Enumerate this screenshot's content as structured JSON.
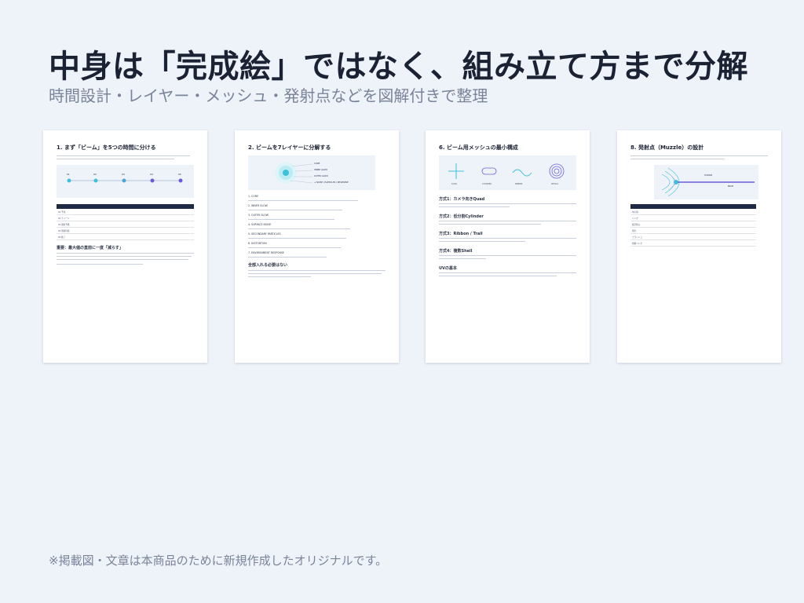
{
  "header": {
    "title": "中身は「完成絵」ではなく、組み立て方まで分解",
    "subtitle": "時間設計・レイヤー・メッシュ・発射点などを図解付きで整理"
  },
  "footer": {
    "note": "※掲載図・文章は本商品のために新規作成したオリジナルです。"
  },
  "pages": [
    {
      "title": "1. まず「ビーム」を5つの時間に分ける",
      "subheading": "重要：最大値の直前に一度「減らす」",
      "timeline_labels": [
        "01",
        "02",
        "03",
        "04",
        "05"
      ],
      "table_rows": [
        [
          "01 予兆",
          "",
          "",
          ""
        ],
        [
          "02 チャージ",
          "",
          "",
          ""
        ],
        [
          "03 発射予備",
          "",
          "",
          ""
        ],
        [
          "04 照射持続",
          "",
          "",
          ""
        ],
        [
          "05 終了",
          "",
          "",
          ""
        ]
      ]
    },
    {
      "title": "2. ビームを7レイヤーに分解する",
      "layers": [
        "1. CORE",
        "2. INNER GLOW",
        "3. OUTER GLOW",
        "4. SURFACE NOISE",
        "5. SECONDARY PARTICLES",
        "6. DISTORTION",
        "7. ENVIRONMENT RESPONSE"
      ],
      "subheading": "全部入れる必要はない",
      "diagram_labels": [
        "CORE",
        "INNER GLOW",
        "OUTER GLOW",
        "+ NOISE / PARTICLES / RESPONSE"
      ]
    },
    {
      "title": "6. ビーム用メッシュの最小構成",
      "sections": [
        "方式1：カメラ向きQuad",
        "方式2：低分割Cylinder",
        "方式3：Ribbon / Trail",
        "方式4：複数Shell",
        "UVの基本"
      ],
      "mesh_labels": [
        "QUAD",
        "CYLINDER",
        "RIBBON",
        "SHELLS"
      ]
    },
    {
      "title": "8. 発射点（Muzzle）の設計",
      "diagram_labels": [
        "CHARGE",
        "BEAM"
      ],
      "table_rows": [
        [
          "中心球",
          "",
          ""
        ],
        [
          "リング",
          "",
          ""
        ],
        [
          "吸引粒子",
          "",
          ""
        ],
        [
          "閃光",
          "",
          ""
        ],
        [
          "フラッシュ",
          "",
          ""
        ],
        [
          "衝撃リング",
          "",
          ""
        ]
      ]
    }
  ],
  "colors": {
    "accent": "#6c5cd6",
    "cyan": "#3fc0d8",
    "navy": "#1f2a44"
  }
}
